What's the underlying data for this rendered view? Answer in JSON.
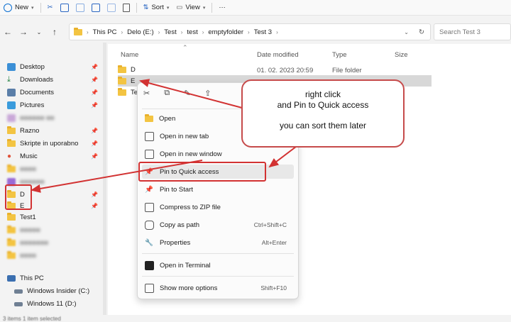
{
  "toolbar": {
    "new_label": "New",
    "sort_label": "Sort",
    "view_label": "View",
    "more_label": "···"
  },
  "address": {
    "crumbs": [
      "This PC",
      "Delo (E:)",
      "Test",
      "test",
      "emptyfolder",
      "Test 3"
    ],
    "search_placeholder": "Search Test 3"
  },
  "sidebar": {
    "items": [
      {
        "label": "Desktop"
      },
      {
        "label": "Downloads"
      },
      {
        "label": "Documents"
      },
      {
        "label": "Pictures"
      },
      {
        "label": "Razno"
      },
      {
        "label": "Skripte in uporabno"
      },
      {
        "label": "Music"
      },
      {
        "label": "D"
      },
      {
        "label": "E"
      },
      {
        "label": "Test1"
      },
      {
        "label": "This PC"
      },
      {
        "label": "Windows Insider (C:)"
      },
      {
        "label": "Windows 11 (D:)"
      }
    ]
  },
  "content": {
    "headers": {
      "name": "Name",
      "date": "Date modified",
      "type": "Type",
      "size": "Size"
    },
    "rows": [
      {
        "name": "D",
        "date": "01. 02. 2023 20:59",
        "type": "File folder"
      },
      {
        "name": "E"
      },
      {
        "name": "Te"
      }
    ]
  },
  "context_menu": {
    "items": [
      {
        "label": "Open",
        "shortcut": ""
      },
      {
        "label": "Open in new tab",
        "shortcut": ""
      },
      {
        "label": "Open in new window",
        "shortcut": ""
      },
      {
        "label": "Pin to Quick access",
        "shortcut": ""
      },
      {
        "label": "Pin to Start",
        "shortcut": ""
      },
      {
        "label": "Compress to ZIP file",
        "shortcut": ""
      },
      {
        "label": "Copy as path",
        "shortcut": "Ctrl+Shift+C"
      },
      {
        "label": "Properties",
        "shortcut": "Alt+Enter"
      },
      {
        "label": "Open in Terminal",
        "shortcut": ""
      },
      {
        "label": "Show more options",
        "shortcut": "Shift+F10"
      }
    ]
  },
  "callout": {
    "line1": "right click",
    "line2": "and Pin to Quick access",
    "line3": "you can sort them later"
  },
  "status": {
    "text": "3 items    1 item selected"
  },
  "colors": {
    "annotation_red": "#d23232",
    "folder_yellow": "#f3c442"
  }
}
